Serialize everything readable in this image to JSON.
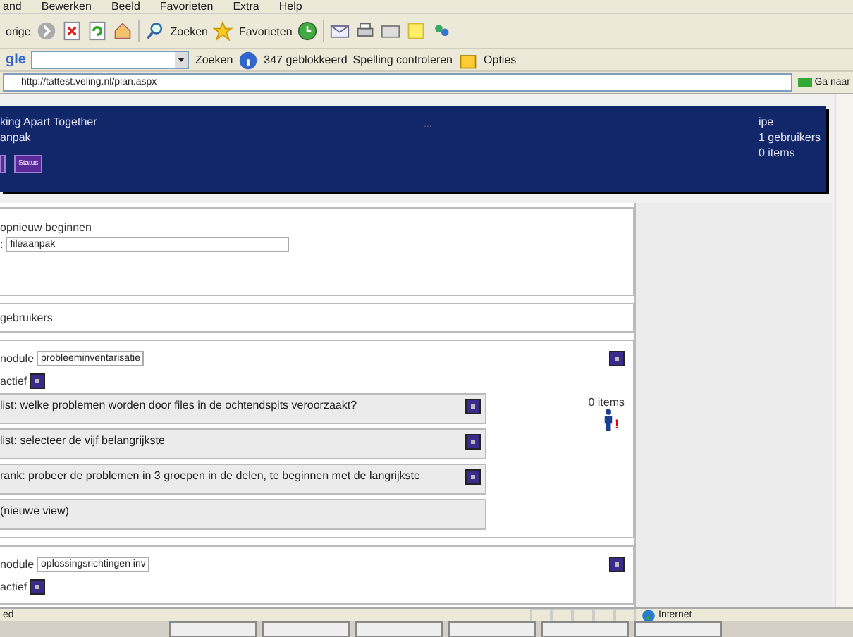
{
  "menu_bar": [
    "and",
    "Bewerken",
    "Beeld",
    "Favorieten",
    "Extra",
    "Help"
  ],
  "toolbar": {
    "back": "orige",
    "search": "Zoeken",
    "favorites": "Favorieten"
  },
  "google_bar": {
    "logo": "gle",
    "search": "Zoeken",
    "blocked": "347 geblokkeerd",
    "spelling": "Spelling controleren",
    "options": "Opties"
  },
  "address_bar": {
    "url": "http://tattest.veling.nl/plan.aspx",
    "go": "Ga naar"
  },
  "header": {
    "title": "king Apart Together",
    "subtitle": "anpak",
    "middle": "...",
    "buttons": [
      "Status"
    ],
    "info": [
      "ipe",
      "1 gebruikers",
      "0 items"
    ]
  },
  "start_panel": {
    "label": "opnieuw beginnen",
    "field_label": ":",
    "field_value": "fileaanpak"
  },
  "users_panel": {
    "label": "gebruikers"
  },
  "modules": [
    {
      "label": "nodule",
      "name": "probleeminventarisatie",
      "active_label": "actief",
      "steps": [
        {
          "text": "list: welke problemen worden door files in de ochtendspits veroorzaakt?",
          "removable": true
        },
        {
          "text": "list: selecteer de vijf belangrijkste",
          "removable": true
        },
        {
          "text": "rank: probeer de problemen in 3 groepen in de delen, te beginnen met de langrijkste",
          "removable": true
        },
        {
          "text": "(nieuwe view)",
          "removable": false
        }
      ],
      "items": "0 items",
      "warning": "!"
    },
    {
      "label": "nodule",
      "name": "oplossingsrichtingen inv",
      "active_label": "actief"
    }
  ],
  "status_bar": {
    "text": "ed",
    "zone": "Internet"
  }
}
